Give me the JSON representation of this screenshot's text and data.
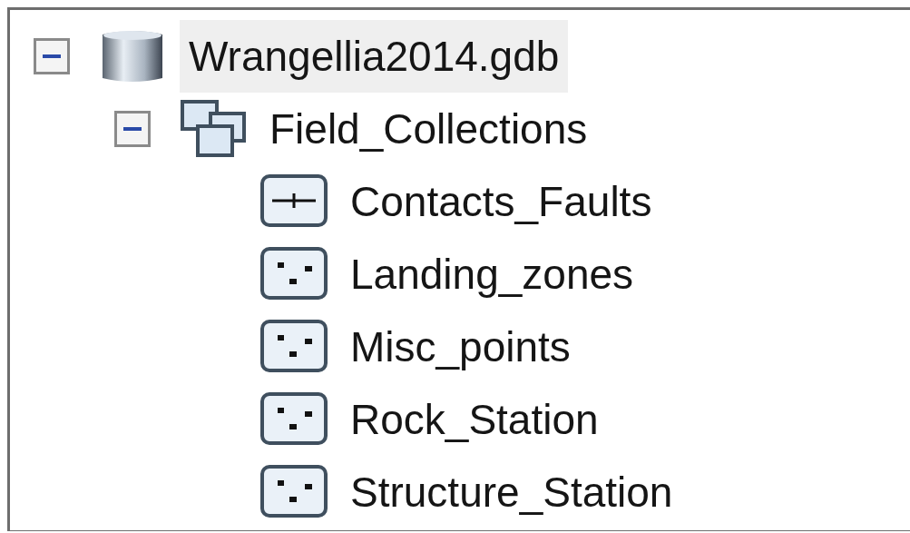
{
  "tree": [
    {
      "label": "Wrangellia2014.gdb",
      "kind": "database",
      "expanded": true,
      "selected": true,
      "children": [
        {
          "label": "Field_Collections",
          "kind": "dataset",
          "expanded": true,
          "selected": false,
          "children": [
            {
              "label": "Contacts_Faults",
              "kind": "line",
              "selected": false
            },
            {
              "label": "Landing_zones",
              "kind": "point",
              "selected": false
            },
            {
              "label": "Misc_points",
              "kind": "point",
              "selected": false
            },
            {
              "label": "Rock_Station",
              "kind": "point",
              "selected": false
            },
            {
              "label": "Structure_Station",
              "kind": "point",
              "selected": false
            }
          ]
        }
      ]
    }
  ]
}
